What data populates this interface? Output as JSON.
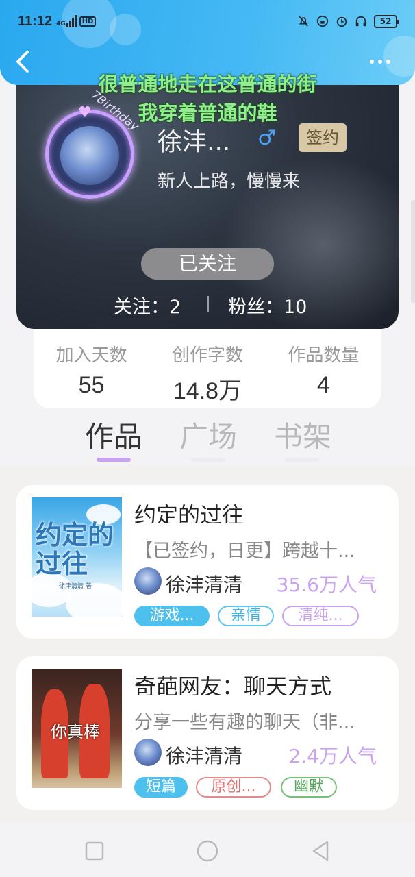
{
  "status_bar": {
    "time": "11:12",
    "network": "4G",
    "hd": "HD",
    "battery": "52"
  },
  "header": {
    "back_icon": "chevron-left-icon",
    "more_icon": "more-dots-icon"
  },
  "lyrics": {
    "line1": "很普通地走在这普通的街",
    "line2": "我穿着普通的鞋"
  },
  "profile": {
    "avatar_caption": "7Birthday",
    "nickname": "徐沣...",
    "gender_symbol": "♂",
    "badge": "签约",
    "bio": "新人上路，慢慢来",
    "follow_button": "已关注",
    "following": "关注：2",
    "followers": "粉丝：10"
  },
  "stats": [
    {
      "label": "加入天数",
      "value": "55"
    },
    {
      "label": "创作字数",
      "value": "14.8万"
    },
    {
      "label": "作品数量",
      "value": "4"
    }
  ],
  "tabs": [
    {
      "label": "作品",
      "active": true
    },
    {
      "label": "广场",
      "active": false
    },
    {
      "label": "书架",
      "active": false
    }
  ],
  "books": [
    {
      "cover_title": "约定的过往",
      "cover_author": "徐沣清清 著",
      "title": "约定的过往",
      "description": "【已签约，日更】跨越十...",
      "author": "徐沣清清",
      "popularity": "35.6万人气",
      "tags": [
        "游戏...",
        "亲情",
        "清纯..."
      ]
    },
    {
      "cover_text": "你真棒",
      "title": "奇葩网友：聊天方式",
      "description": "分享一些有趣的聊天（非...",
      "author": "徐沣清清",
      "popularity": "2.4万人气",
      "tags": [
        "短篇",
        "原创...",
        "幽默"
      ]
    }
  ],
  "colors": {
    "header_blue": "#2aa8ef",
    "tab_indicator": "#c9a3f0",
    "popularity": "#c9a3f0",
    "lyric_green": "#8ef08a",
    "gender_blue": "#4aa3ff"
  }
}
